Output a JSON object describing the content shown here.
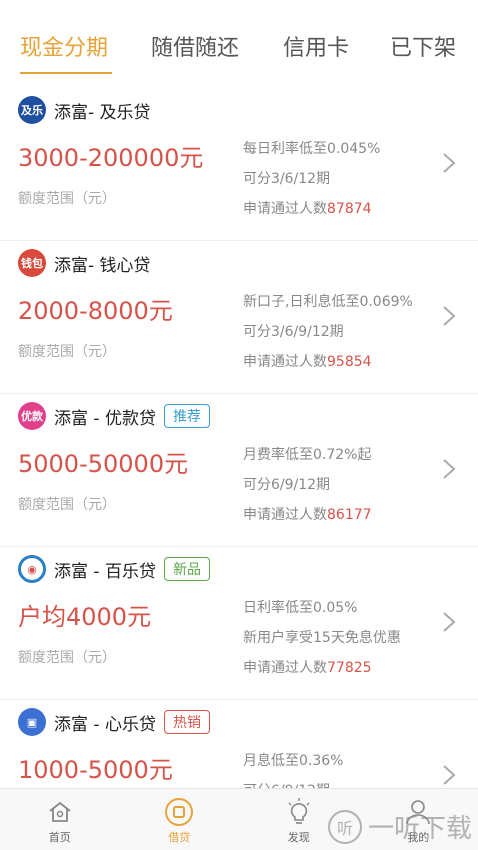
{
  "tabs": [
    {
      "label": "现金分期",
      "active": true
    },
    {
      "label": "随借随还",
      "active": false
    },
    {
      "label": "信用卡",
      "active": false
    },
    {
      "label": "已下架",
      "active": false
    }
  ],
  "colors": {
    "accent": "#e8a23a",
    "amount": "#d6534a"
  },
  "products": [
    {
      "logo_text": "及乐",
      "logo_color": "#1f4fa0",
      "title": "添富- 及乐贷",
      "tag": "",
      "amount": "3000-200000元",
      "range_label": "额度范围（元）",
      "info1": "每日利率低至0.045%",
      "info2": "可分3/6/12期",
      "applicants_label": "申请通过人数",
      "applicants": "87874"
    },
    {
      "logo_text": "钱包",
      "logo_color": "#d84a3c",
      "title": "添富- 钱心贷",
      "tag": "",
      "amount": "2000-8000元",
      "range_label": "额度范围（元）",
      "info1": "新口子,日利息低至0.069%",
      "info2": "可分3/6/9/12期",
      "applicants_label": "申请通过人数",
      "applicants": "95854"
    },
    {
      "logo_text": "优款",
      "logo_color": "#e0408a",
      "title": "添富 - 优款贷",
      "tag": "推荐",
      "tag_color": "#3a9ccf",
      "amount": "5000-50000元",
      "range_label": "额度范围（元）",
      "info1": "月费率低至0.72%起",
      "info2": "可分6/9/12期",
      "applicants_label": "申请通过人数",
      "applicants": "86177"
    },
    {
      "logo_text": "◉",
      "logo_color": "#2a7fc7",
      "title": "添富 - 百乐贷",
      "tag": "新品",
      "tag_color": "#5aa84a",
      "amount": "户均4000元",
      "range_label": "额度范围（元）",
      "info1": "日利率低至0.05%",
      "info2": "新用户享受15天免息优惠",
      "applicants_label": "申请通过人数",
      "applicants": "77825"
    },
    {
      "logo_text": "▣",
      "logo_color": "#3b6fd1",
      "title": "添富 - 心乐贷",
      "tag": "热销",
      "tag_color": "#d6534a",
      "amount": "1000-5000元",
      "range_label": "",
      "info1": "月息低至0.36%",
      "info2": "可分6/9/12期",
      "applicants_label": "",
      "applicants": ""
    }
  ],
  "bottom_nav": [
    {
      "label": "首页",
      "icon": "home-icon",
      "active": false
    },
    {
      "label": "借贷",
      "icon": "loan-icon",
      "active": true
    },
    {
      "label": "发现",
      "icon": "bulb-icon",
      "active": false
    },
    {
      "label": "我的",
      "icon": "user-icon",
      "active": false
    }
  ],
  "watermark": {
    "logo": "听",
    "text": "一听下载"
  }
}
